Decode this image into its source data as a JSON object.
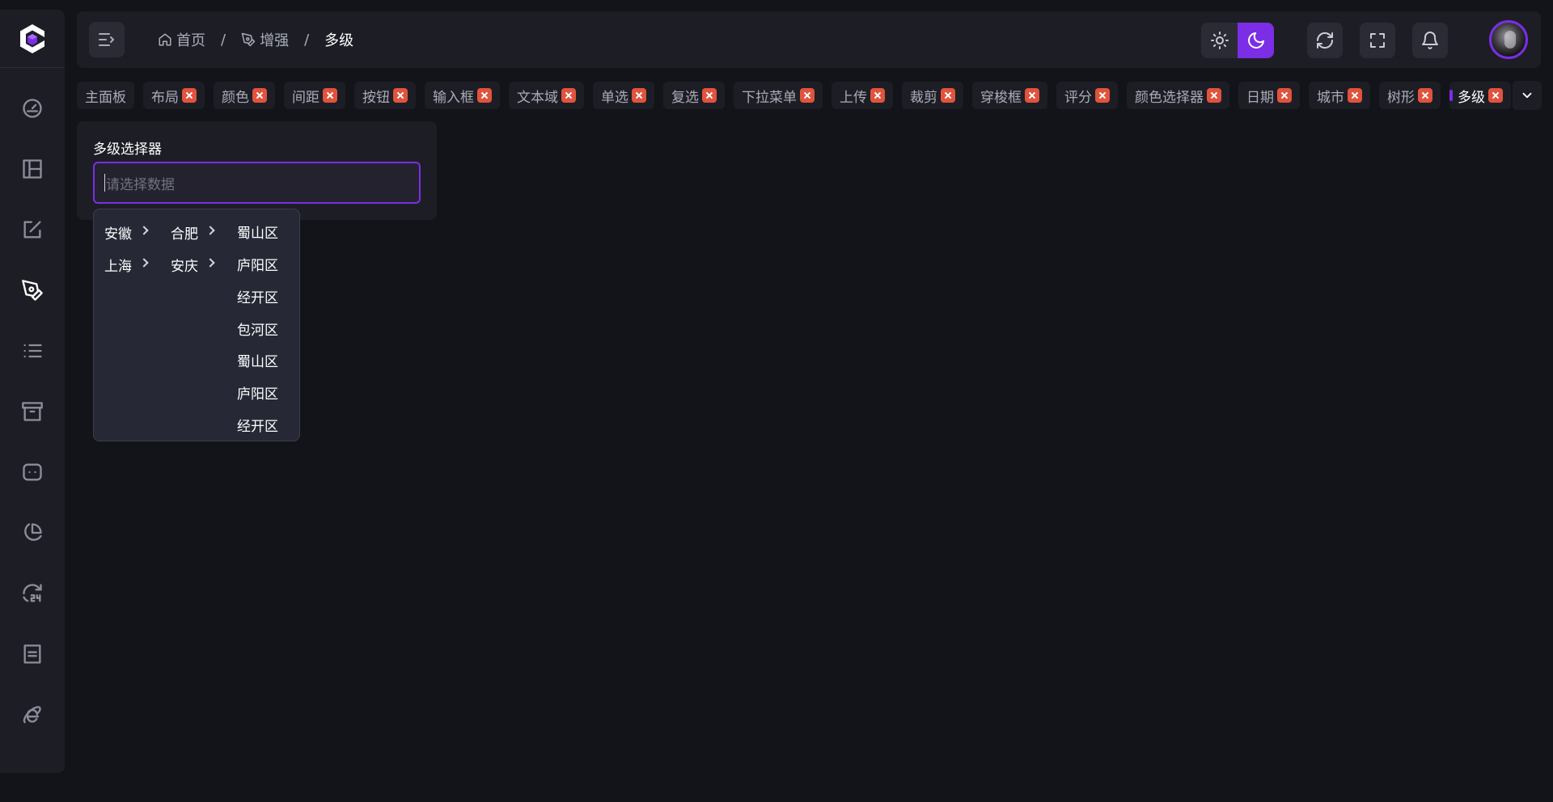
{
  "colors": {
    "accent": "#7b2ee6",
    "background": "#131419",
    "panel": "#1d1e25",
    "tab_close": "#e1533c"
  },
  "sidebar": {
    "logo_icon": "brand-logo-icon",
    "items": [
      {
        "icon": "dashboard-gauge-icon"
      },
      {
        "icon": "layout-icon"
      },
      {
        "icon": "edit-icon"
      },
      {
        "icon": "pen-tool-icon",
        "active": true
      },
      {
        "icon": "list-icon"
      },
      {
        "icon": "archive-icon"
      },
      {
        "icon": "bot-icon"
      },
      {
        "icon": "pie-chart-icon"
      },
      {
        "icon": "clock-24h-icon"
      },
      {
        "icon": "document-icon"
      },
      {
        "icon": "ie-icon"
      }
    ]
  },
  "header": {
    "breadcrumb": [
      {
        "label": "首页",
        "icon": "home-icon"
      },
      {
        "label": "增强",
        "icon": "pen-tool-icon"
      },
      {
        "label": "多级"
      }
    ],
    "separator": "/",
    "theme": {
      "options": [
        "light",
        "dark"
      ],
      "selected": "dark"
    }
  },
  "tabs": [
    {
      "label": "主面板",
      "closable": false
    },
    {
      "label": "布局",
      "closable": true
    },
    {
      "label": "颜色",
      "closable": true
    },
    {
      "label": "间距",
      "closable": true
    },
    {
      "label": "按钮",
      "closable": true
    },
    {
      "label": "输入框",
      "closable": true
    },
    {
      "label": "文本域",
      "closable": true
    },
    {
      "label": "单选",
      "closable": true
    },
    {
      "label": "复选",
      "closable": true
    },
    {
      "label": "下拉菜单",
      "closable": true
    },
    {
      "label": "上传",
      "closable": true
    },
    {
      "label": "裁剪",
      "closable": true
    },
    {
      "label": "穿梭框",
      "closable": true
    },
    {
      "label": "评分",
      "closable": true
    },
    {
      "label": "颜色选择器",
      "closable": true
    },
    {
      "label": "日期",
      "closable": true
    },
    {
      "label": "城市",
      "closable": true
    },
    {
      "label": "树形",
      "closable": true
    },
    {
      "label": "多级",
      "closable": true,
      "active": true
    }
  ],
  "main": {
    "card_title": "多级选择器",
    "cascader_placeholder": "请选择数据",
    "cascader": {
      "level1": [
        "安徽",
        "上海"
      ],
      "level2": [
        "合肥",
        "安庆"
      ],
      "level3": [
        "蜀山区",
        "庐阳区",
        "经开区",
        "包河区",
        "蜀山区",
        "庐阳区",
        "经开区"
      ]
    }
  }
}
